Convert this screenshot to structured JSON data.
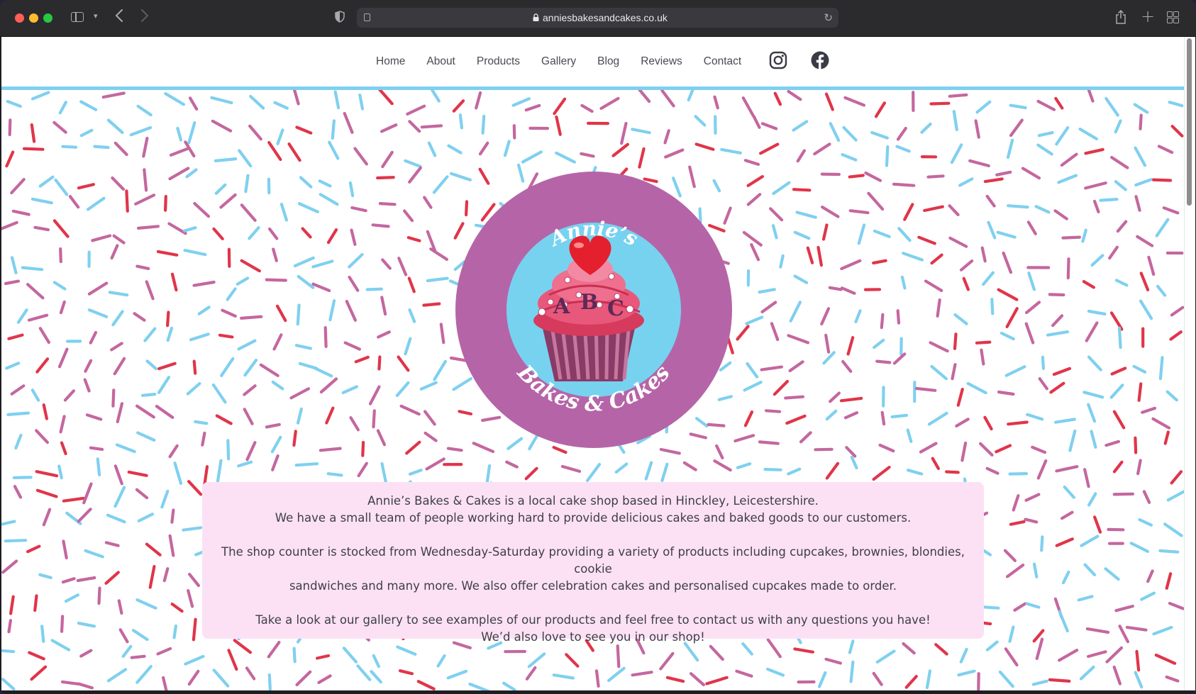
{
  "browser": {
    "url": "anniesbakesandcakes.co.uk"
  },
  "nav": {
    "items": [
      "Home",
      "About",
      "Products",
      "Gallery",
      "Blog",
      "Reviews",
      "Contact"
    ]
  },
  "social": {
    "icons": [
      "instagram-icon",
      "facebook-icon"
    ]
  },
  "logo": {
    "top_text": "Annie’s",
    "bottom_text": "Bakes & Cakes",
    "letters": [
      "A",
      "B",
      "C"
    ]
  },
  "intro": {
    "line1": "Annie’s Bakes & Cakes is a local cake shop based in Hinckley, Leicestershire.",
    "line2": "We have a small team of people working hard to provide delicious cakes and baked goods to our customers.",
    "line3": "The shop counter is stocked from Wednesday-Saturday providing a variety of products including cupcakes, brownies, blondies, cookie",
    "line4": "sandwiches and many more. We also offer celebration cakes and personalised cupcakes made to order.",
    "line5": "Take a look at our gallery to see examples of our products and feel free to contact us with any questions you have!",
    "line6": "We’d also love to see you in our shop!"
  },
  "colors": {
    "accent_blue": "#7fd0ef",
    "logo_purple": "#b565a7",
    "info_box_pink": "#fce1f5",
    "sprinkle_pink": "#c4679f",
    "sprinkle_red": "#e0354a"
  }
}
